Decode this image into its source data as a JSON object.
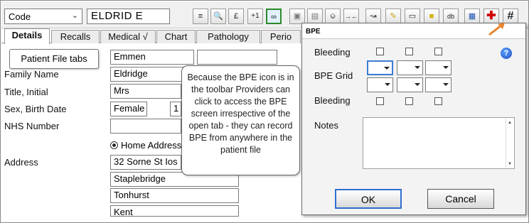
{
  "toolbar": {
    "code_select": "Code",
    "patient_name": "ELDRID E",
    "plus_one": "+1",
    "pound": "£"
  },
  "tabs": [
    {
      "label": "Details",
      "active": true
    },
    {
      "label": "Recalls"
    },
    {
      "label": "Medical √"
    },
    {
      "label": "Chart"
    },
    {
      "label": "Pathology"
    },
    {
      "label": "Perio"
    }
  ],
  "form": {
    "first_name_value": "Emmen",
    "family_name_label": "Family Name",
    "family_name_value": "Eldridge",
    "title_label": "Title, Initial",
    "title_value": "Mrs",
    "sex_label": "Sex, Birth Date",
    "sex_value": "Female",
    "birth_date_partial": "1",
    "nhs_label": "NHS Number",
    "home_address_radio": "Home Address",
    "address_label": "Address",
    "address_lines": [
      "32 Sorne St   Ios",
      "Staplebridge",
      "Tonhurst",
      "Kent"
    ]
  },
  "annotations": {
    "patient_file_tabs": "Patient File tabs",
    "bpe_callout": "Because the BPE icon is in the toolbar Providers can click to access the BPE screen irrespective of the open tab - they can record BPE from anywhere in the patient file"
  },
  "bpe_dialog": {
    "title": "BPE",
    "bleeding_label": "Bleeding",
    "bpe_grid_label": "BPE Grid",
    "bleeding_label_2": "Bleeding",
    "notes_label": "Notes",
    "ok_label": "OK",
    "cancel_label": "Cancel"
  },
  "colors": {
    "arrow": "#e8822a",
    "active_toolbar": "#2b8a2b",
    "focus": "#3a7bd5"
  }
}
